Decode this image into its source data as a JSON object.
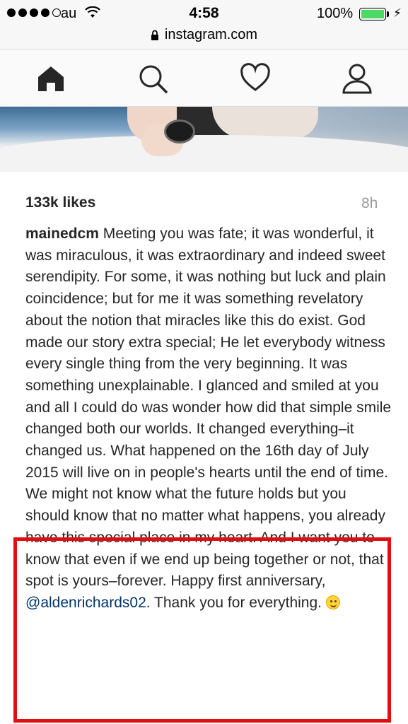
{
  "status_bar": {
    "carrier": "au",
    "time": "4:58",
    "battery_percent": "100%",
    "battery_level": 1.0,
    "signal_bars_filled": 4,
    "signal_bars_total": 5
  },
  "browser": {
    "url": "instagram.com"
  },
  "nav": {
    "items": [
      "home-icon",
      "search-icon",
      "heart-icon",
      "profile-icon"
    ],
    "active": "home-icon"
  },
  "post": {
    "likes": "133k likes",
    "time_ago": "8h",
    "username": "mainedcm",
    "caption_part1": "Meeting you was fate; it was wonderful, it was miraculous, it was extraordinary and indeed sweet serendipity. For some, it was nothing but luck and plain coincidence; but for me it was something revelatory about the notion that miracles like this do exist. God made our story extra special; He let everybody witness every single thing from the very beginning. It was something unexplainable. I glanced and smiled at you and all I could do was wonder how did that simple smile changed both our worlds. It changed everything–it changed us. What happened on the 16th day of July 2015 will live on in people's hearts until the end of time. We might not know what the future holds but you should know that no matter what happens, you already have this special place in my heart. And I want you to know that even if we end up being together or not, that spot is yours–forever. Happy first anniversary, ",
    "mention": "@aldenrichards02",
    "caption_part2": ". Thank you for everything. ",
    "emoji": "smiling-face-emoji"
  },
  "colors": {
    "highlight_border": "#e01010",
    "mention": "#003569",
    "battery": "#4cd964",
    "muted_text": "#999999"
  }
}
